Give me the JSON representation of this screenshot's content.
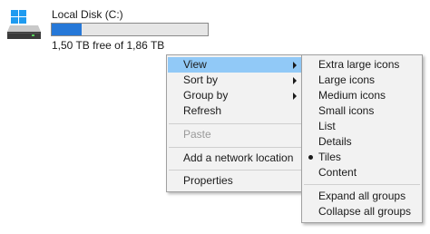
{
  "drive": {
    "name": "Local Disk (C:)",
    "free_text": "1,50 TB free of 1,86 TB",
    "used_fraction": 0.19,
    "bar_color": "#2678d8",
    "icon": "hard-drive-icon"
  },
  "context_menu": {
    "items": [
      {
        "label": "View",
        "has_submenu": true,
        "highlighted": true
      },
      {
        "label": "Sort by",
        "has_submenu": true
      },
      {
        "label": "Group by",
        "has_submenu": true
      },
      {
        "label": "Refresh"
      },
      {
        "label": "Paste",
        "disabled": true
      },
      {
        "label": "Add a network location"
      },
      {
        "label": "Properties"
      }
    ]
  },
  "view_submenu": {
    "items": [
      {
        "label": "Extra large icons"
      },
      {
        "label": "Large icons"
      },
      {
        "label": "Medium icons"
      },
      {
        "label": "Small icons"
      },
      {
        "label": "List"
      },
      {
        "label": "Details"
      },
      {
        "label": "Tiles",
        "selected": true
      },
      {
        "label": "Content"
      },
      {
        "label": "Expand all groups"
      },
      {
        "label": "Collapse all groups"
      }
    ]
  },
  "colors": {
    "highlight": "#91c9f7",
    "menu_background": "#f2f2f2",
    "disabled_text": "#9a9a9a"
  }
}
